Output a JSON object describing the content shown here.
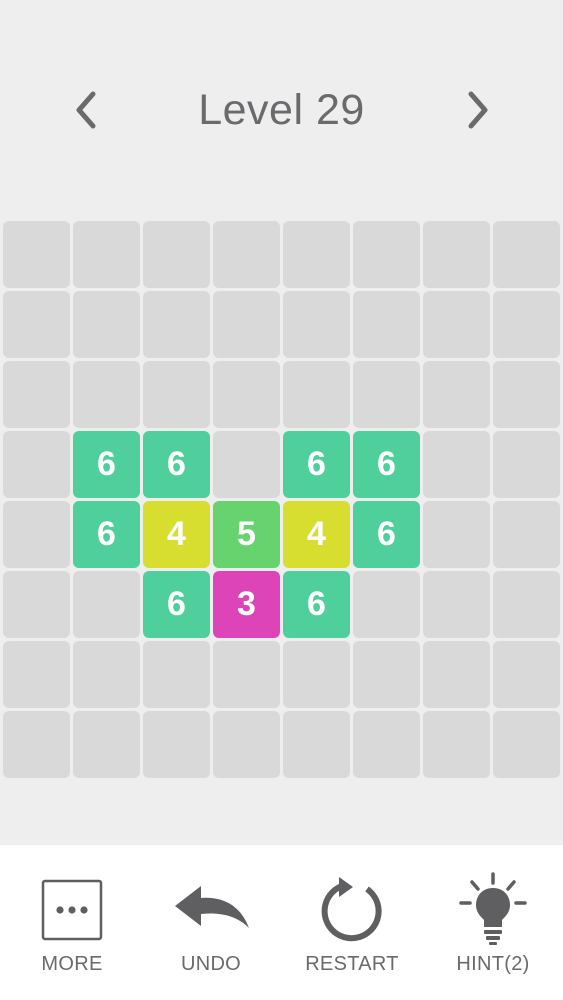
{
  "header": {
    "title": "Level 29",
    "prev_icon": "chevron-left-icon",
    "next_icon": "chevron-right-icon"
  },
  "colors": {
    "empty": "#d9d9da",
    "6": "#4fcf9b",
    "5": "#66d36e",
    "4": "#d8de30",
    "3": "#dd44b8"
  },
  "board": {
    "rows": 8,
    "cols": 8,
    "cells": [
      [
        null,
        null,
        null,
        null,
        null,
        null,
        null,
        null
      ],
      [
        null,
        null,
        null,
        null,
        null,
        null,
        null,
        null
      ],
      [
        null,
        null,
        null,
        null,
        null,
        null,
        null,
        null
      ],
      [
        null,
        "6",
        "6",
        null,
        "6",
        "6",
        null,
        null
      ],
      [
        null,
        "6",
        "4",
        "5",
        "4",
        "6",
        null,
        null
      ],
      [
        null,
        null,
        "6",
        "3",
        "6",
        null,
        null,
        null
      ],
      [
        null,
        null,
        null,
        null,
        null,
        null,
        null,
        null
      ],
      [
        null,
        null,
        null,
        null,
        null,
        null,
        null,
        null
      ]
    ]
  },
  "toolbar": {
    "more_label": "MORE",
    "undo_label": "UNDO",
    "restart_label": "RESTART",
    "hint_label": "HINT(2)"
  }
}
